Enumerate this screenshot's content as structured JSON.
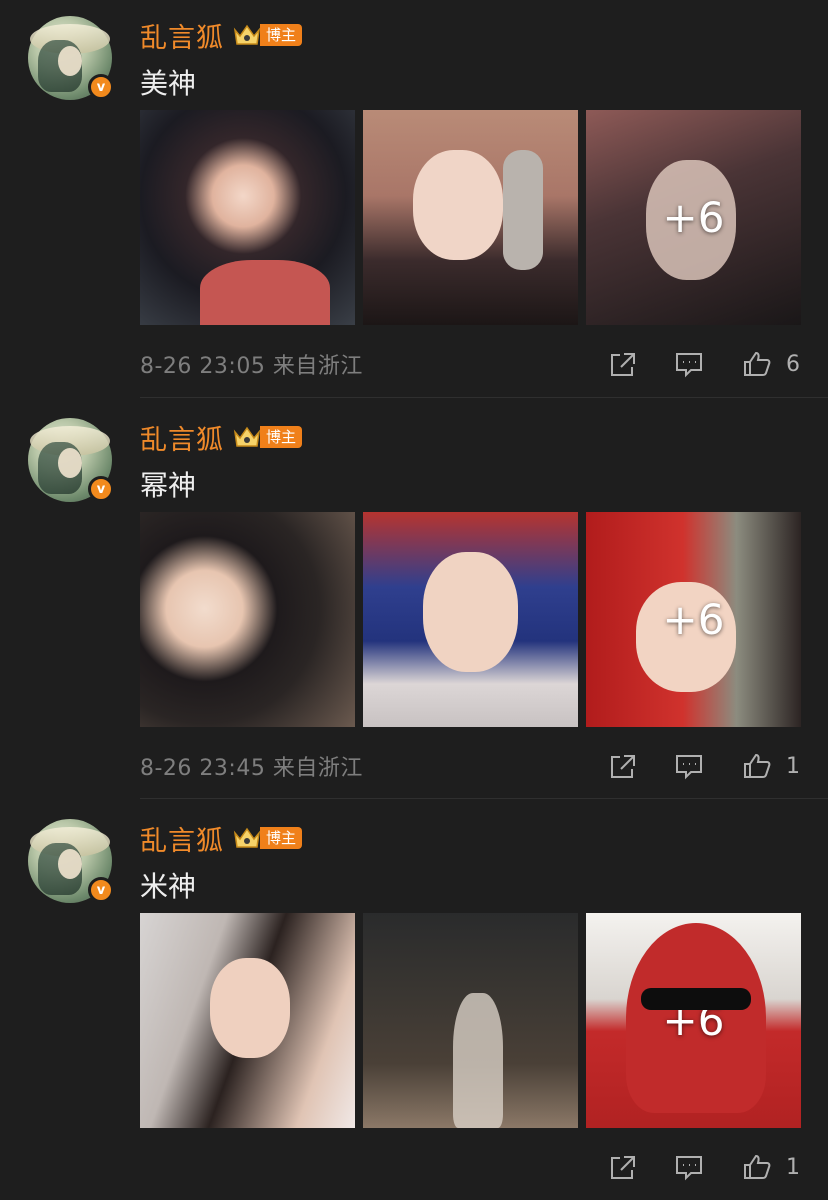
{
  "posts": [
    {
      "username": "乱言狐",
      "badge_label": "博主",
      "text": "美神",
      "more_count": "+6",
      "timestamp": "8-26 23:05",
      "source": "来自浙江",
      "likes": "6"
    },
    {
      "username": "乱言狐",
      "badge_label": "博主",
      "text": "幂神",
      "more_count": "+6",
      "timestamp": "8-26 23:45",
      "source": "来自浙江",
      "likes": "1"
    },
    {
      "username": "乱言狐",
      "badge_label": "博主",
      "text": "米神",
      "more_count": "+6",
      "timestamp": "",
      "source": "",
      "likes": "1"
    }
  ],
  "colors": {
    "background": "#1e1e1e",
    "username": "#f08a2a",
    "badge": "#f0801a",
    "verified": "#f28a1d",
    "meta_text": "#7e7e7e"
  },
  "icons": [
    "verified-icon",
    "crown-icon",
    "share-icon",
    "comment-icon",
    "like-icon"
  ]
}
